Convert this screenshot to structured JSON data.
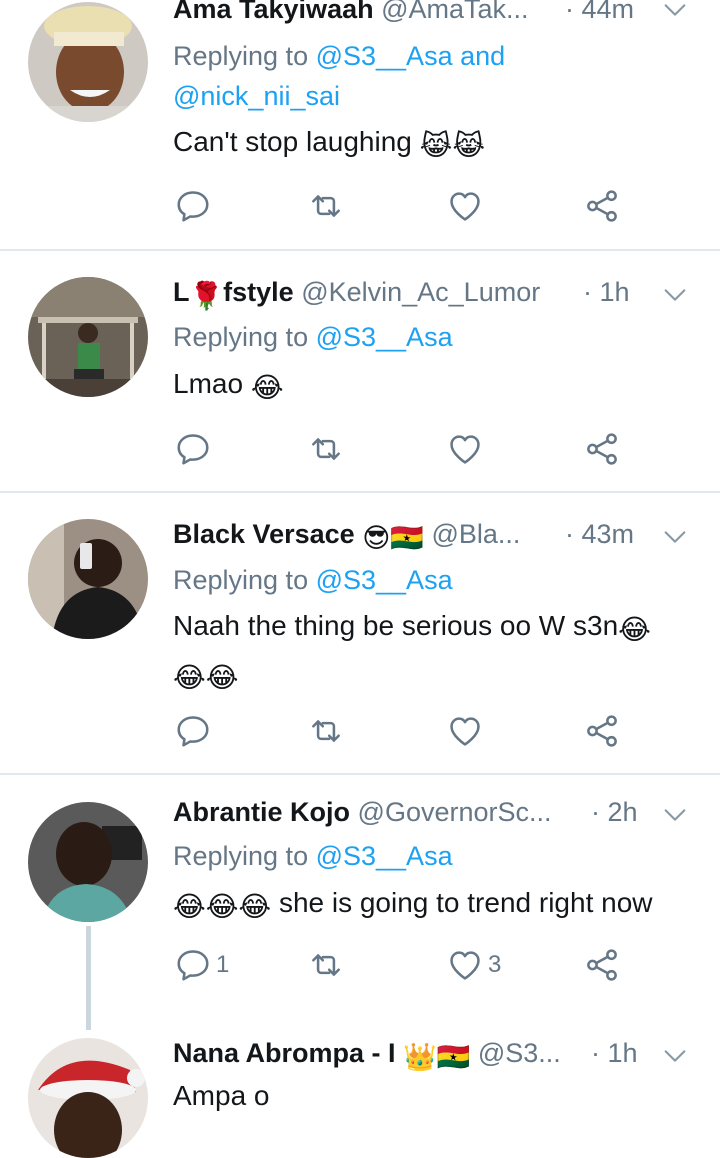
{
  "tweets": [
    {
      "name": "Ama Takyiwaah",
      "handle": "@AmaTak...",
      "time": "· 44m",
      "replying_prefix": "Replying to ",
      "replying_mentions": "@S3__Asa and",
      "replying_mentions2": "@nick_nii_sai",
      "text": "Can't stop laughing",
      "text_emoji": "😹😹"
    },
    {
      "name_prefix": "L",
      "name_emoji": "🌹",
      "name": "fstyle",
      "handle": "@Kelvin_Ac_Lumor",
      "time": "· 1h",
      "replying_prefix": "Replying to ",
      "replying_mentions": "@S3__Asa",
      "text": "Lmao",
      "text_emoji": "😂"
    },
    {
      "name": "Black Versace",
      "name_emoji": "😎🇬🇭",
      "handle": "@Bla...",
      "time": "· 43m",
      "replying_prefix": "Replying to ",
      "replying_mentions": "@S3__Asa",
      "text": "Naah the thing be serious oo W s3n",
      "text_emoji": "😂",
      "text_emoji2": "😂😂"
    },
    {
      "name": "Abrantie Kojo",
      "handle": "@GovernorSc...",
      "time": "· 2h",
      "replying_prefix": "Replying to ",
      "replying_mentions": "@S3__Asa",
      "text_emoji": "😂😂😂",
      "text": "she is going to trend right now",
      "reply_count": "1",
      "like_count": "3"
    },
    {
      "name": "Nana Abrompa - I",
      "name_emoji": "👑🇬🇭",
      "handle": "@S3...",
      "time": "· 1h",
      "text": "Ampa o"
    }
  ],
  "colors": {
    "text": "#14171a",
    "secondary": "#657786",
    "link": "#1da1f2",
    "divider": "#e1e8ed"
  },
  "icons": [
    "reply-icon",
    "retweet-icon",
    "like-icon",
    "share-icon",
    "chevron-down-icon"
  ]
}
